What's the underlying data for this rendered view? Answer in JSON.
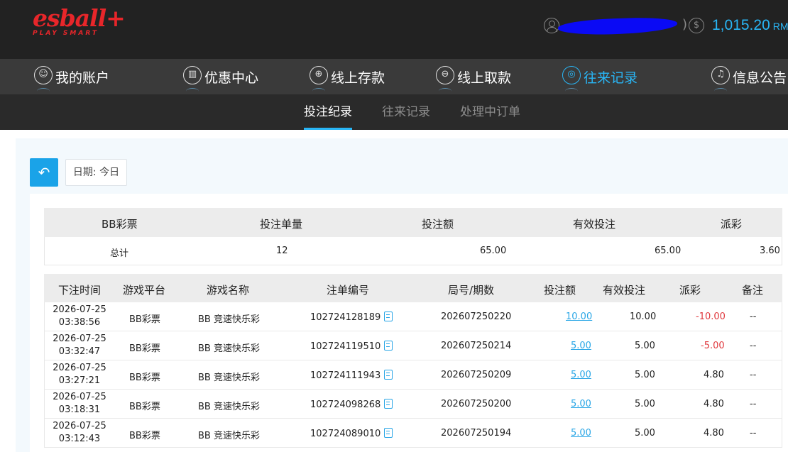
{
  "header": {
    "logo_text": "esball+",
    "logo_tagline": "PLAY SMART",
    "balance_value": "1,015.20",
    "balance_currency": "RMB",
    "paren": ")",
    "coin_symbol": "$"
  },
  "main_nav": [
    {
      "label": "我的账户",
      "icon": "user-icon",
      "glyph": "☺"
    },
    {
      "label": "优惠中心",
      "icon": "gift-icon",
      "glyph": "▥"
    },
    {
      "label": "线上存款",
      "icon": "deposit-icon",
      "glyph": "⊕"
    },
    {
      "label": "线上取款",
      "icon": "withdraw-icon",
      "glyph": "⊖"
    },
    {
      "label": "往来记录",
      "icon": "records-icon",
      "glyph": "◎",
      "active": true
    },
    {
      "label": "信息公告",
      "icon": "bell-icon",
      "glyph": "♫"
    }
  ],
  "sub_nav": [
    {
      "label": "投注纪录",
      "active": true
    },
    {
      "label": "往来记录"
    },
    {
      "label": "处理中订单"
    }
  ],
  "filter": {
    "back_glyph": "↶",
    "date_label": "日期: 今日"
  },
  "summary": {
    "headers": [
      "BB彩票",
      "投注单量",
      "投注额",
      "有效投注",
      "派彩"
    ],
    "row": [
      "总计",
      "12",
      "65.00",
      "65.00",
      "3.60"
    ]
  },
  "bets": {
    "headers": [
      "下注时间",
      "游戏平台",
      "游戏名称",
      "注单编号",
      "局号/期数",
      "投注额",
      "有效投注",
      "派彩",
      "备注"
    ],
    "rows": [
      {
        "date": "2026-07-25",
        "time": "03:38:56",
        "platform": "BB彩票",
        "game": "BB 竞速快乐彩",
        "bet_id": "102724128189",
        "round": "202607250220",
        "amount": "10.00",
        "valid": "10.00",
        "payout": "-10.00",
        "note": "--"
      },
      {
        "date": "2026-07-25",
        "time": "03:32:47",
        "platform": "BB彩票",
        "game": "BB 竞速快乐彩",
        "bet_id": "102724119510",
        "round": "202607250214",
        "amount": "5.00",
        "valid": "5.00",
        "payout": "-5.00",
        "note": "--"
      },
      {
        "date": "2026-07-25",
        "time": "03:27:21",
        "platform": "BB彩票",
        "game": "BB 竞速快乐彩",
        "bet_id": "102724111943",
        "round": "202607250209",
        "amount": "5.00",
        "valid": "5.00",
        "payout": "4.80",
        "note": "--"
      },
      {
        "date": "2026-07-25",
        "time": "03:18:31",
        "platform": "BB彩票",
        "game": "BB 竞速快乐彩",
        "bet_id": "102724098268",
        "round": "202607250200",
        "amount": "5.00",
        "valid": "5.00",
        "payout": "4.80",
        "note": "--"
      },
      {
        "date": "2026-07-25",
        "time": "03:12:43",
        "platform": "BB彩票",
        "game": "BB 竞速快乐彩",
        "bet_id": "102724089010",
        "round": "202607250194",
        "amount": "5.00",
        "valid": "5.00",
        "payout": "4.80",
        "note": "--"
      }
    ]
  },
  "colors": {
    "accent": "#29b6f6",
    "negative": "#e0393e",
    "header_bg": "#222222",
    "nav_bg": "#3a3a3a",
    "logo": "#e8262a"
  }
}
